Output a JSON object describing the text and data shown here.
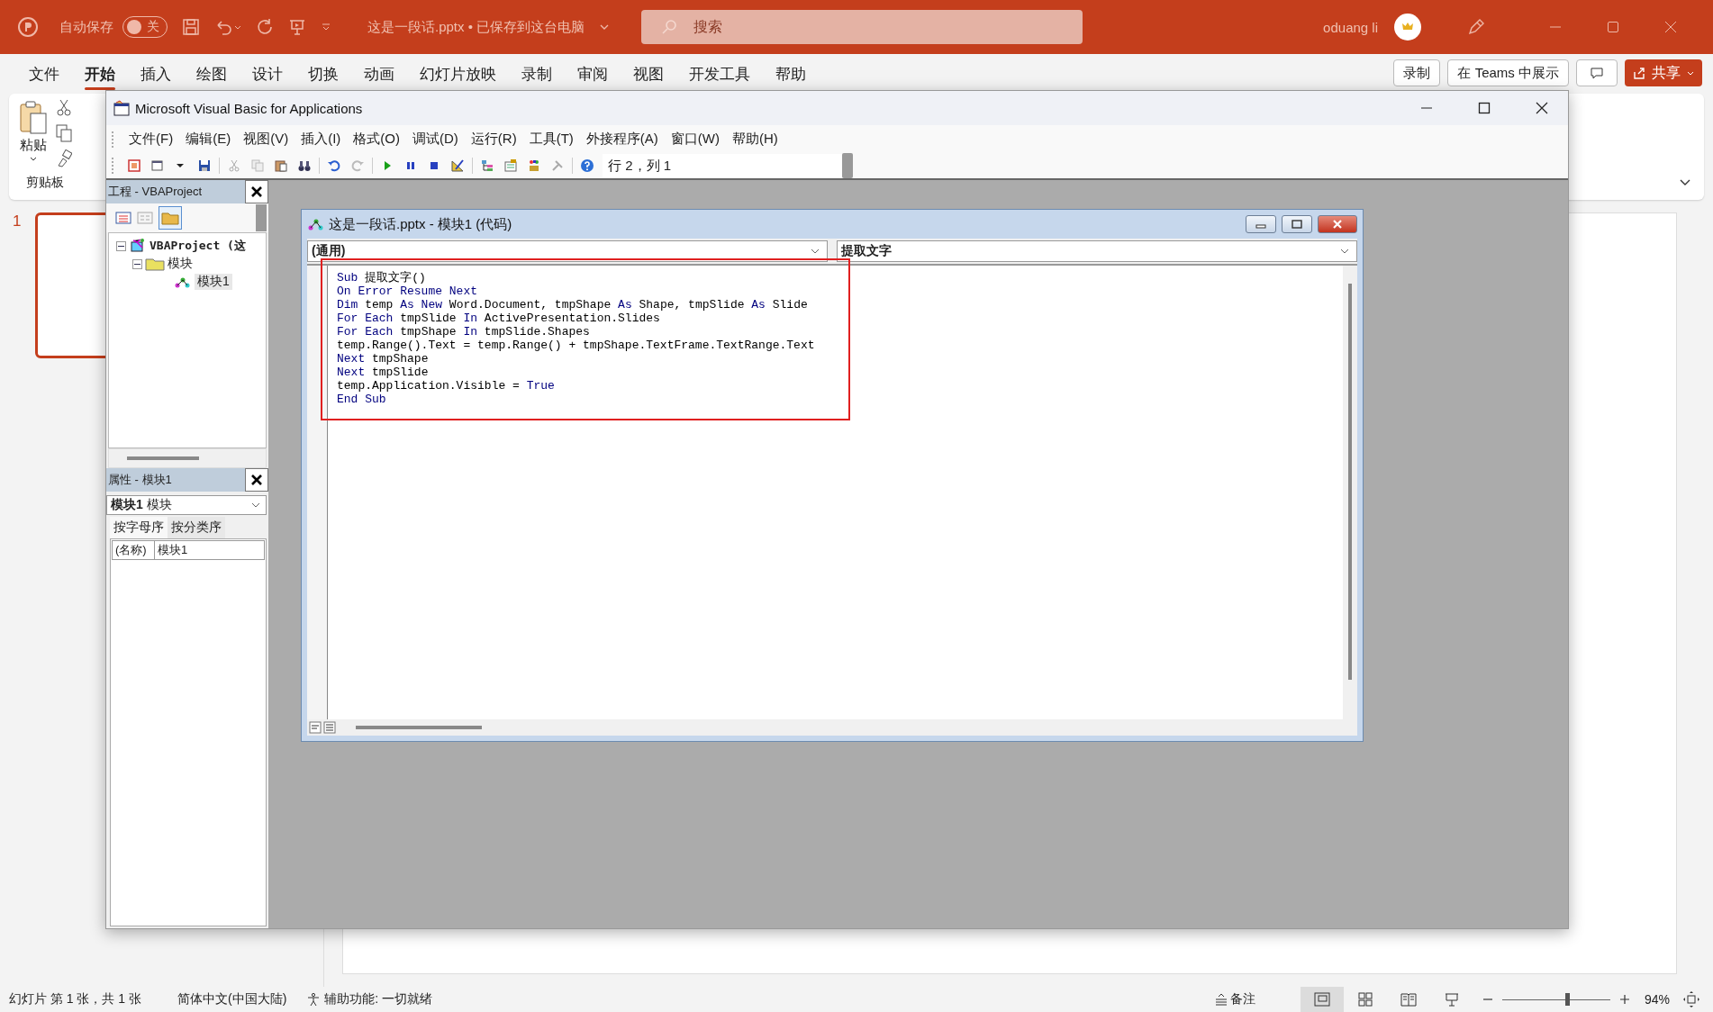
{
  "powerpoint": {
    "title_bar": {
      "autosave_label": "自动保存",
      "autosave_toggle": {
        "on": false,
        "label": "关"
      },
      "document_title": "这是一段话.pptx • 已保存到这台电脑",
      "search": {
        "placeholder": "搜索"
      },
      "user_name": "oduang li"
    },
    "ribbon_tabs": [
      {
        "label": "文件",
        "selected": false
      },
      {
        "label": "开始",
        "selected": true
      },
      {
        "label": "插入",
        "selected": false
      },
      {
        "label": "绘图",
        "selected": false
      },
      {
        "label": "设计",
        "selected": false
      },
      {
        "label": "切换",
        "selected": false
      },
      {
        "label": "动画",
        "selected": false
      },
      {
        "label": "幻灯片放映",
        "selected": false
      },
      {
        "label": "录制",
        "selected": false
      },
      {
        "label": "审阅",
        "selected": false
      },
      {
        "label": "视图",
        "selected": false
      },
      {
        "label": "开发工具",
        "selected": false
      },
      {
        "label": "帮助",
        "selected": false
      }
    ],
    "ribbon_buttons": [
      "录制",
      "在 Teams 中展示"
    ],
    "share_button": "共享",
    "clipboard": {
      "paste_label": "粘贴",
      "group_label": "剪贴板"
    },
    "slide_thumbnails": [
      {
        "number": "1",
        "selected": true
      }
    ],
    "status_bar": {
      "slide_info": "幻灯片 第 1 张，共 1 张",
      "language": "简体中文(中国大陆)",
      "accessibility": "辅助功能: 一切就绪",
      "notes": "备注",
      "zoom": {
        "level": 0.6,
        "reading": "94%"
      }
    }
  },
  "vba_window": {
    "title": "Microsoft Visual Basic for Applications",
    "menu": [
      "文件(F)",
      "编辑(E)",
      "视图(V)",
      "插入(I)",
      "格式(O)",
      "调试(D)",
      "运行(R)",
      "工具(T)",
      "外接程序(A)",
      "窗口(W)",
      "帮助(H)"
    ],
    "position": "行 2，列 1",
    "project_pane": {
      "title": "工程 - VBAProject",
      "tree": [
        {
          "label": "VBAProject (这",
          "expanded": true,
          "children": [
            {
              "label": "模块",
              "expanded": true,
              "children": [
                {
                  "label": "模块1",
                  "selected": true
                }
              ]
            }
          ]
        }
      ]
    },
    "properties_pane": {
      "title": "属性 - 模块1",
      "object": {
        "name": "模块1",
        "type": "模块"
      },
      "tabs": [
        {
          "label": "按字母序",
          "selected": true
        },
        {
          "label": "按分类序",
          "selected": false
        }
      ],
      "rows": [
        {
          "name": "(名称)",
          "value": "模块1"
        }
      ]
    },
    "code_window": {
      "title": "这是一段话.pptx - 模块1 (代码)",
      "object_dropdown": "(通用)",
      "procedure_dropdown": "提取文字",
      "lines": [
        [
          {
            "text": "Sub",
            "kind": "keyword"
          },
          {
            "text": " 提取文字()",
            "kind": "plain"
          }
        ],
        [
          {
            "text": "On Error Resume Next",
            "kind": "keyword"
          }
        ],
        [
          {
            "text": "Dim",
            "kind": "keyword"
          },
          {
            "text": " temp ",
            "kind": "plain"
          },
          {
            "text": "As New",
            "kind": "keyword"
          },
          {
            "text": " Word.Document, tmpShape ",
            "kind": "plain"
          },
          {
            "text": "As",
            "kind": "keyword"
          },
          {
            "text": " Shape, tmpSlide ",
            "kind": "plain"
          },
          {
            "text": "As",
            "kind": "keyword"
          },
          {
            "text": " Slide",
            "kind": "plain"
          }
        ],
        [
          {
            "text": "For Each",
            "kind": "keyword"
          },
          {
            "text": " tmpSlide ",
            "kind": "plain"
          },
          {
            "text": "In",
            "kind": "keyword"
          },
          {
            "text": " ActivePresentation.Slides",
            "kind": "plain"
          }
        ],
        [
          {
            "text": "For Each",
            "kind": "keyword"
          },
          {
            "text": " tmpShape ",
            "kind": "plain"
          },
          {
            "text": "In",
            "kind": "keyword"
          },
          {
            "text": " tmpSlide.Shapes",
            "kind": "plain"
          }
        ],
        [
          {
            "text": "temp.Range().Text = temp.Range() + tmpShape.TextFrame.TextRange.Text",
            "kind": "plain"
          }
        ],
        [
          {
            "text": "Next",
            "kind": "keyword"
          },
          {
            "text": " tmpShape",
            "kind": "plain"
          }
        ],
        [
          {
            "text": "Next",
            "kind": "keyword"
          },
          {
            "text": " tmpSlide",
            "kind": "plain"
          }
        ],
        [
          {
            "text": "temp.Application.Visible = ",
            "kind": "plain"
          },
          {
            "text": "True",
            "kind": "keyword"
          }
        ],
        [
          {
            "text": "End Sub",
            "kind": "keyword"
          }
        ]
      ]
    }
  }
}
